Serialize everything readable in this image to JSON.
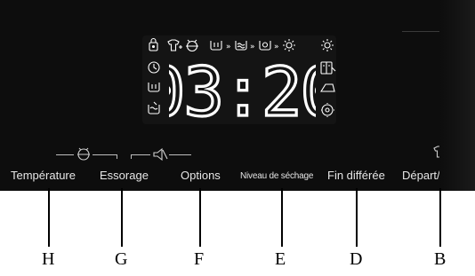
{
  "display": {
    "time": "03:20",
    "color": "#ffffff"
  },
  "display_icons": {
    "top_row": [
      "child-lock-icon",
      "steam-shirt-icon",
      "allergy-icon",
      "prewash-icon",
      "arrow-icon",
      "wash-icon",
      "arrow-icon",
      "spin-icon",
      "arrow-icon",
      "sun-icon",
      "extra-dry-icon"
    ],
    "left_column": [
      "clock-icon",
      "tub-icon",
      "rinse-icon"
    ],
    "right_column": [
      "wardrobe-icon",
      "iron-icon",
      "delay-icon"
    ]
  },
  "groups": {
    "temperature_icon": "temperature-icon",
    "spin_mute_icon": "mute-icon",
    "start_icon": "shirt-icon"
  },
  "buttons": [
    {
      "id": "temperature",
      "label": "Température"
    },
    {
      "id": "spin",
      "label": "Essorage"
    },
    {
      "id": "options",
      "label": "Options"
    },
    {
      "id": "dry",
      "label": "Niveau de séchage"
    },
    {
      "id": "delay",
      "label": "Fin différée"
    },
    {
      "id": "start",
      "label": "Départ/Pause"
    }
  ],
  "callouts": [
    "H",
    "G",
    "F",
    "E",
    "D",
    "B"
  ]
}
